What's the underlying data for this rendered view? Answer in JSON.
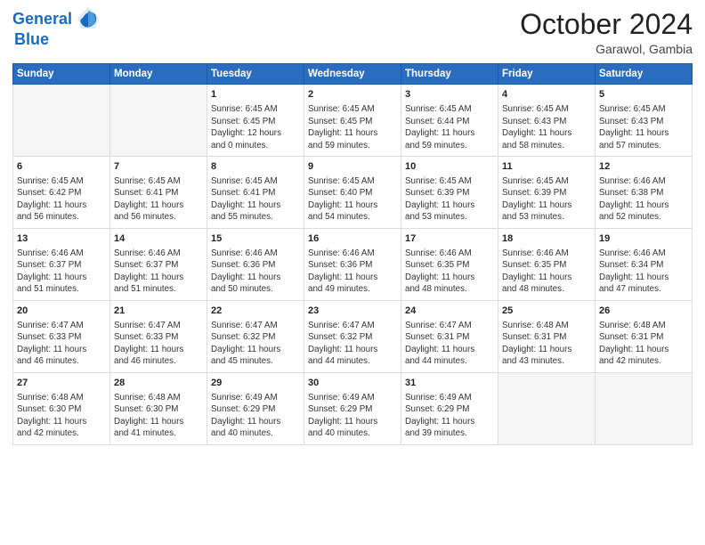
{
  "header": {
    "logo_line1": "General",
    "logo_line2": "Blue",
    "month_title": "October 2024",
    "location": "Garawol, Gambia"
  },
  "columns": [
    "Sunday",
    "Monday",
    "Tuesday",
    "Wednesday",
    "Thursday",
    "Friday",
    "Saturday"
  ],
  "weeks": [
    [
      {
        "day": "",
        "detail": ""
      },
      {
        "day": "",
        "detail": ""
      },
      {
        "day": "1",
        "detail": "Sunrise: 6:45 AM\nSunset: 6:45 PM\nDaylight: 12 hours\nand 0 minutes."
      },
      {
        "day": "2",
        "detail": "Sunrise: 6:45 AM\nSunset: 6:45 PM\nDaylight: 11 hours\nand 59 minutes."
      },
      {
        "day": "3",
        "detail": "Sunrise: 6:45 AM\nSunset: 6:44 PM\nDaylight: 11 hours\nand 59 minutes."
      },
      {
        "day": "4",
        "detail": "Sunrise: 6:45 AM\nSunset: 6:43 PM\nDaylight: 11 hours\nand 58 minutes."
      },
      {
        "day": "5",
        "detail": "Sunrise: 6:45 AM\nSunset: 6:43 PM\nDaylight: 11 hours\nand 57 minutes."
      }
    ],
    [
      {
        "day": "6",
        "detail": "Sunrise: 6:45 AM\nSunset: 6:42 PM\nDaylight: 11 hours\nand 56 minutes."
      },
      {
        "day": "7",
        "detail": "Sunrise: 6:45 AM\nSunset: 6:41 PM\nDaylight: 11 hours\nand 56 minutes."
      },
      {
        "day": "8",
        "detail": "Sunrise: 6:45 AM\nSunset: 6:41 PM\nDaylight: 11 hours\nand 55 minutes."
      },
      {
        "day": "9",
        "detail": "Sunrise: 6:45 AM\nSunset: 6:40 PM\nDaylight: 11 hours\nand 54 minutes."
      },
      {
        "day": "10",
        "detail": "Sunrise: 6:45 AM\nSunset: 6:39 PM\nDaylight: 11 hours\nand 53 minutes."
      },
      {
        "day": "11",
        "detail": "Sunrise: 6:45 AM\nSunset: 6:39 PM\nDaylight: 11 hours\nand 53 minutes."
      },
      {
        "day": "12",
        "detail": "Sunrise: 6:46 AM\nSunset: 6:38 PM\nDaylight: 11 hours\nand 52 minutes."
      }
    ],
    [
      {
        "day": "13",
        "detail": "Sunrise: 6:46 AM\nSunset: 6:37 PM\nDaylight: 11 hours\nand 51 minutes."
      },
      {
        "day": "14",
        "detail": "Sunrise: 6:46 AM\nSunset: 6:37 PM\nDaylight: 11 hours\nand 51 minutes."
      },
      {
        "day": "15",
        "detail": "Sunrise: 6:46 AM\nSunset: 6:36 PM\nDaylight: 11 hours\nand 50 minutes."
      },
      {
        "day": "16",
        "detail": "Sunrise: 6:46 AM\nSunset: 6:36 PM\nDaylight: 11 hours\nand 49 minutes."
      },
      {
        "day": "17",
        "detail": "Sunrise: 6:46 AM\nSunset: 6:35 PM\nDaylight: 11 hours\nand 48 minutes."
      },
      {
        "day": "18",
        "detail": "Sunrise: 6:46 AM\nSunset: 6:35 PM\nDaylight: 11 hours\nand 48 minutes."
      },
      {
        "day": "19",
        "detail": "Sunrise: 6:46 AM\nSunset: 6:34 PM\nDaylight: 11 hours\nand 47 minutes."
      }
    ],
    [
      {
        "day": "20",
        "detail": "Sunrise: 6:47 AM\nSunset: 6:33 PM\nDaylight: 11 hours\nand 46 minutes."
      },
      {
        "day": "21",
        "detail": "Sunrise: 6:47 AM\nSunset: 6:33 PM\nDaylight: 11 hours\nand 46 minutes."
      },
      {
        "day": "22",
        "detail": "Sunrise: 6:47 AM\nSunset: 6:32 PM\nDaylight: 11 hours\nand 45 minutes."
      },
      {
        "day": "23",
        "detail": "Sunrise: 6:47 AM\nSunset: 6:32 PM\nDaylight: 11 hours\nand 44 minutes."
      },
      {
        "day": "24",
        "detail": "Sunrise: 6:47 AM\nSunset: 6:31 PM\nDaylight: 11 hours\nand 44 minutes."
      },
      {
        "day": "25",
        "detail": "Sunrise: 6:48 AM\nSunset: 6:31 PM\nDaylight: 11 hours\nand 43 minutes."
      },
      {
        "day": "26",
        "detail": "Sunrise: 6:48 AM\nSunset: 6:31 PM\nDaylight: 11 hours\nand 42 minutes."
      }
    ],
    [
      {
        "day": "27",
        "detail": "Sunrise: 6:48 AM\nSunset: 6:30 PM\nDaylight: 11 hours\nand 42 minutes."
      },
      {
        "day": "28",
        "detail": "Sunrise: 6:48 AM\nSunset: 6:30 PM\nDaylight: 11 hours\nand 41 minutes."
      },
      {
        "day": "29",
        "detail": "Sunrise: 6:49 AM\nSunset: 6:29 PM\nDaylight: 11 hours\nand 40 minutes."
      },
      {
        "day": "30",
        "detail": "Sunrise: 6:49 AM\nSunset: 6:29 PM\nDaylight: 11 hours\nand 40 minutes."
      },
      {
        "day": "31",
        "detail": "Sunrise: 6:49 AM\nSunset: 6:29 PM\nDaylight: 11 hours\nand 39 minutes."
      },
      {
        "day": "",
        "detail": ""
      },
      {
        "day": "",
        "detail": ""
      }
    ]
  ]
}
